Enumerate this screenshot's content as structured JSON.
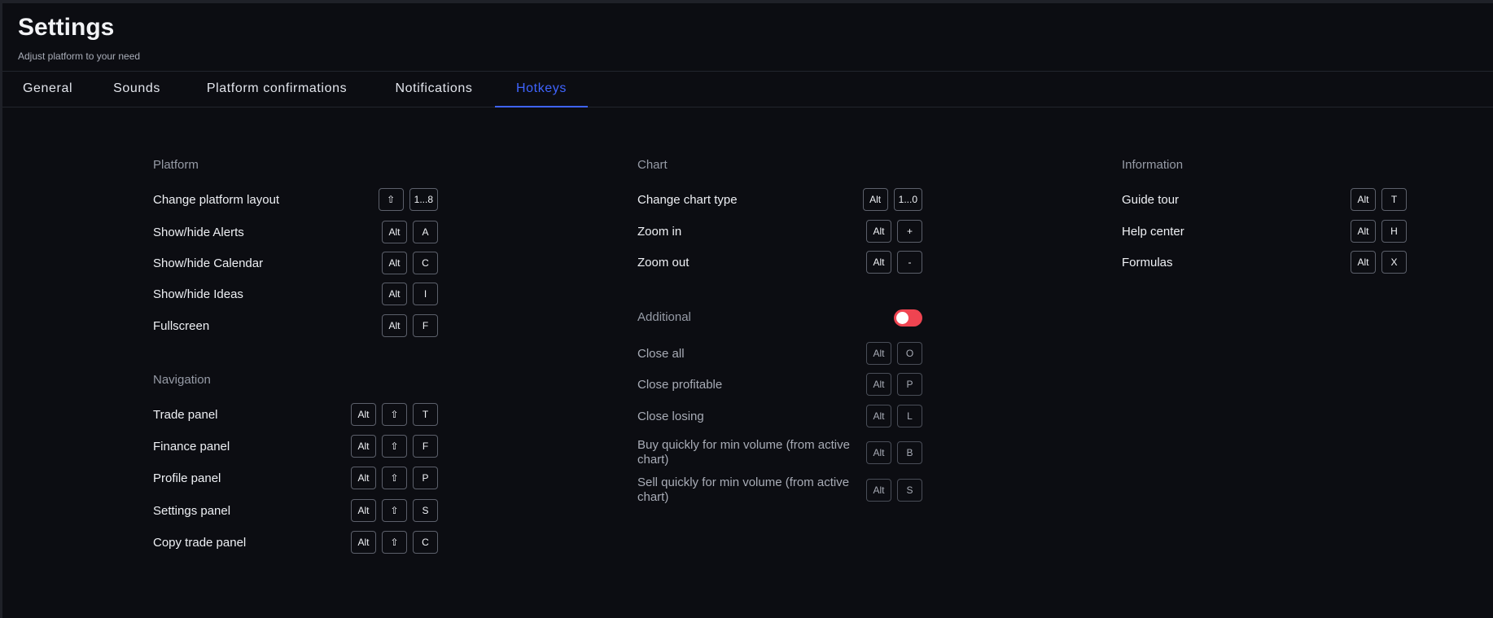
{
  "header": {
    "title": "Settings",
    "subtitle": "Adjust platform to your need"
  },
  "tabs": [
    {
      "label": "General",
      "active": false
    },
    {
      "label": "Sounds",
      "active": false
    },
    {
      "label": "Platform confirmations",
      "active": false
    },
    {
      "label": "Notifications",
      "active": false
    },
    {
      "label": "Hotkeys",
      "active": true
    }
  ],
  "platform": {
    "title": "Platform",
    "rows": [
      {
        "label": "Change platform layout",
        "keys": [
          "⇧",
          "1...8"
        ]
      },
      {
        "label": "Show/hide Alerts",
        "keys": [
          "Alt",
          "A"
        ]
      },
      {
        "label": "Show/hide Calendar",
        "keys": [
          "Alt",
          "C"
        ]
      },
      {
        "label": "Show/hide Ideas",
        "keys": [
          "Alt",
          "I"
        ]
      },
      {
        "label": "Fullscreen",
        "keys": [
          "Alt",
          "F"
        ]
      }
    ]
  },
  "navigation": {
    "title": "Navigation",
    "rows": [
      {
        "label": "Trade panel",
        "keys": [
          "Alt",
          "⇧",
          "T"
        ]
      },
      {
        "label": "Finance panel",
        "keys": [
          "Alt",
          "⇧",
          "F"
        ]
      },
      {
        "label": "Profile panel",
        "keys": [
          "Alt",
          "⇧",
          "P"
        ]
      },
      {
        "label": "Settings panel",
        "keys": [
          "Alt",
          "⇧",
          "S"
        ]
      },
      {
        "label": "Copy trade panel",
        "keys": [
          "Alt",
          "⇧",
          "C"
        ]
      }
    ]
  },
  "chart": {
    "title": "Chart",
    "rows": [
      {
        "label": "Change chart type",
        "keys": [
          "Alt",
          "1...0"
        ]
      },
      {
        "label": "Zoom in",
        "keys": [
          "Alt",
          "+"
        ]
      },
      {
        "label": "Zoom out",
        "keys": [
          "Alt",
          "-"
        ]
      }
    ]
  },
  "additional": {
    "title": "Additional",
    "toggle_on": false,
    "toggle_color": "#ef4451",
    "rows": [
      {
        "label": "Close all",
        "keys": [
          "Alt",
          "O"
        ]
      },
      {
        "label": "Close profitable",
        "keys": [
          "Alt",
          "P"
        ]
      },
      {
        "label": "Close losing",
        "keys": [
          "Alt",
          "L"
        ]
      },
      {
        "label": "Buy quickly for min volume (from active chart)",
        "keys": [
          "Alt",
          "B"
        ]
      },
      {
        "label": "Sell quickly for min volume (from active chart)",
        "keys": [
          "Alt",
          "S"
        ]
      }
    ]
  },
  "information": {
    "title": "Information",
    "rows": [
      {
        "label": "Guide tour",
        "keys": [
          "Alt",
          "T"
        ]
      },
      {
        "label": "Help center",
        "keys": [
          "Alt",
          "H"
        ]
      },
      {
        "label": "Formulas",
        "keys": [
          "Alt",
          "X"
        ]
      }
    ]
  },
  "colors": {
    "background": "#0c0d12",
    "accent": "#3f64ff",
    "toggle": "#ef4451"
  }
}
